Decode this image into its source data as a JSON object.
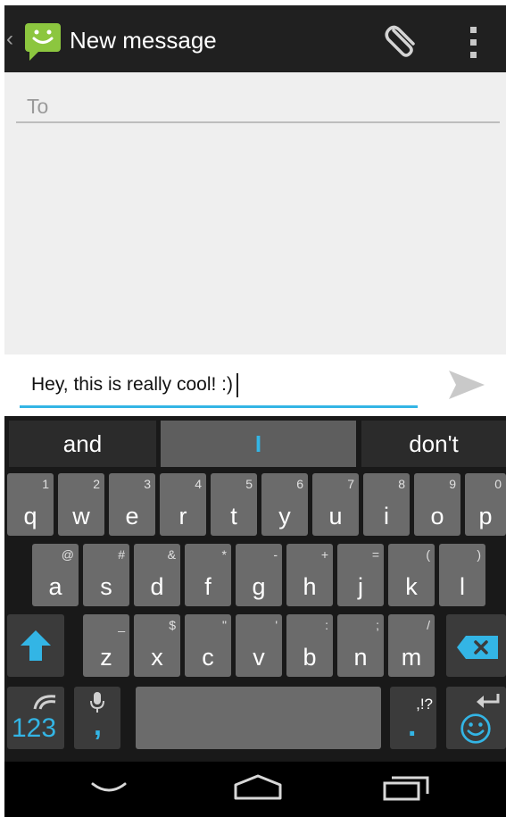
{
  "header": {
    "title": "New message",
    "back_glyph": "‹"
  },
  "compose": {
    "to_placeholder": "To",
    "message_text": "Hey,  this is really cool! :)"
  },
  "keyboard": {
    "suggestions": [
      "and",
      "I",
      "don't"
    ],
    "rows": [
      [
        {
          "k": "q",
          "s": "1"
        },
        {
          "k": "w",
          "s": "2"
        },
        {
          "k": "e",
          "s": "3"
        },
        {
          "k": "r",
          "s": "4"
        },
        {
          "k": "t",
          "s": "5"
        },
        {
          "k": "y",
          "s": "6"
        },
        {
          "k": "u",
          "s": "7"
        },
        {
          "k": "i",
          "s": "8"
        },
        {
          "k": "o",
          "s": "9"
        },
        {
          "k": "p",
          "s": "0"
        }
      ],
      [
        {
          "k": "a",
          "s": "@"
        },
        {
          "k": "s",
          "s": "#"
        },
        {
          "k": "d",
          "s": "&"
        },
        {
          "k": "f",
          "s": "*"
        },
        {
          "k": "g",
          "s": "-"
        },
        {
          "k": "h",
          "s": "+"
        },
        {
          "k": "j",
          "s": "="
        },
        {
          "k": "k",
          "s": "("
        },
        {
          "k": "l",
          "s": ")"
        }
      ],
      [
        {
          "k": "z",
          "s": "_"
        },
        {
          "k": "x",
          "s": "$"
        },
        {
          "k": "c",
          "s": "\""
        },
        {
          "k": "v",
          "s": "'"
        },
        {
          "k": "b",
          "s": ":"
        },
        {
          "k": "n",
          "s": ";"
        },
        {
          "k": "m",
          "s": "/"
        }
      ]
    ],
    "bottom": {
      "numbers": "123",
      "comma": ",",
      "period": ".",
      "punct_hint": ",!?"
    }
  },
  "colors": {
    "accent": "#33b5e5",
    "app_green": "#8cc63f"
  }
}
